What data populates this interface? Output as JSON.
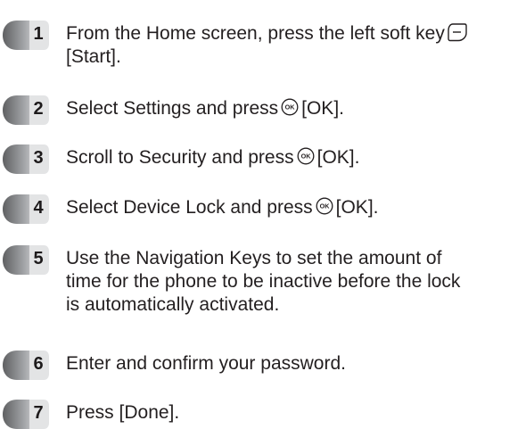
{
  "steps": [
    {
      "number": "1",
      "lines": [
        "From the Home screen, press the left soft key",
        "[Start]."
      ],
      "icon": "left-soft-key-icon"
    },
    {
      "number": "2",
      "before": "Select Settings and press",
      "after": "[OK].",
      "icon": "ok-key-icon"
    },
    {
      "number": "3",
      "before": "Scroll to Security and press",
      "after": "[OK].",
      "icon": "ok-key-icon"
    },
    {
      "number": "4",
      "before": "Select Device Lock and press",
      "after": "[OK].",
      "icon": "ok-key-icon"
    },
    {
      "number": "5",
      "lines": [
        "Use the Navigation Keys to set the amount of",
        "time for the phone to be inactive before the lock",
        "is automatically activated."
      ]
    },
    {
      "number": "6",
      "text": "Enter and confirm your password."
    },
    {
      "number": "7",
      "text": "Press [Done]."
    }
  ],
  "ok_icon_label": "OK",
  "colors": {
    "badge_dark": "#6d6e70",
    "badge_light": "#d9dadb",
    "badge_mid": "#a7a9ac",
    "text": "#231f20"
  }
}
